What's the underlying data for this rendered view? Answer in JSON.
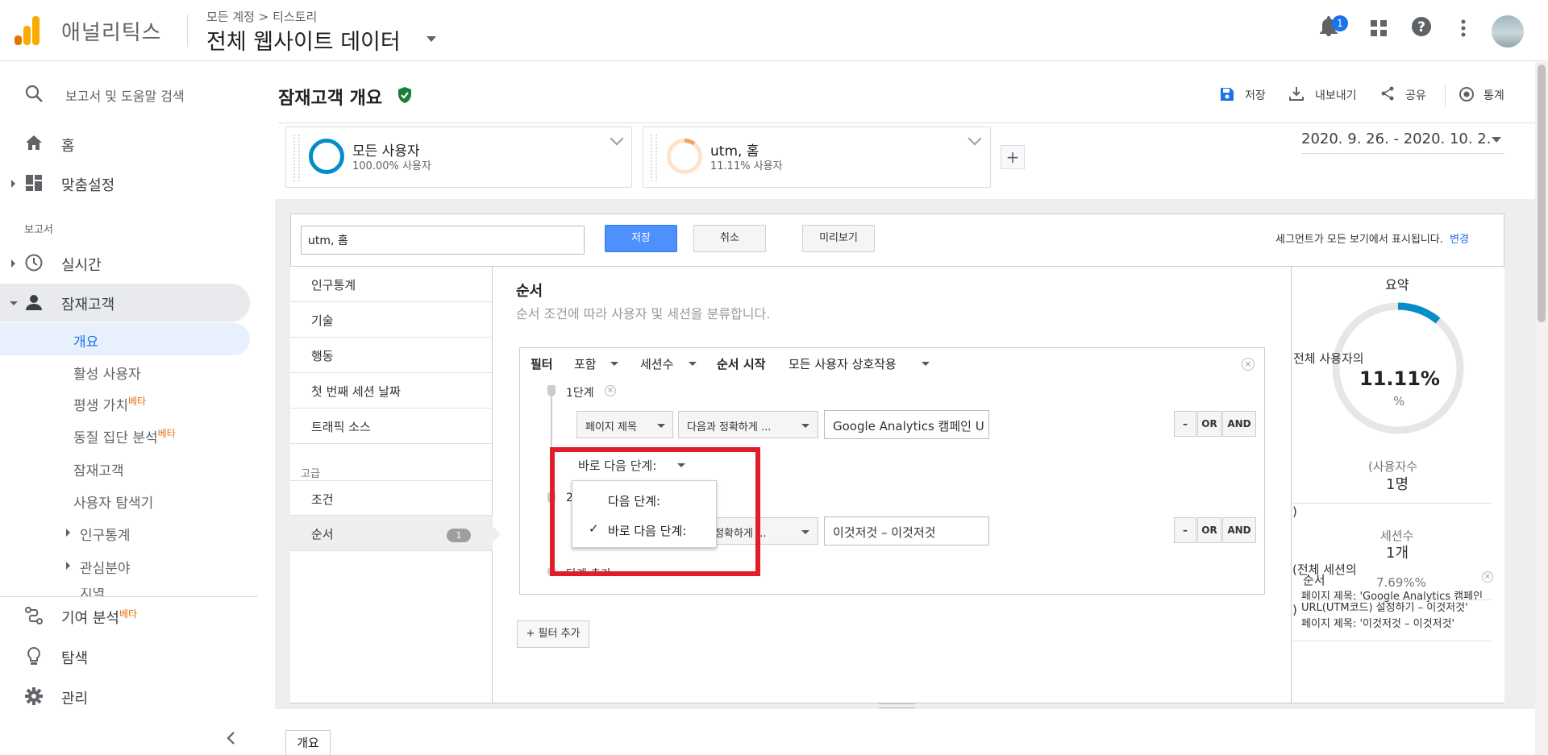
{
  "header": {
    "app_name": "애널리틱스",
    "breadcrumb_account": "모든 계정",
    "breadcrumb_sep": ">",
    "breadcrumb_property": "티스토리",
    "view_name": "전체 웹사이트 데이터",
    "notification_count": "1",
    "icons": [
      "bell-icon",
      "apps-icon",
      "help-icon",
      "more-vert-icon",
      "avatar"
    ]
  },
  "sidebar": {
    "search_placeholder": "보고서 및 도움말 검색",
    "home": "홈",
    "customization": "맞춤설정",
    "reports_section": "보고서",
    "realtime": "실시간",
    "audience": "잠재고객",
    "audience_items": [
      {
        "label": "개요",
        "beta": ""
      },
      {
        "label": "활성 사용자",
        "beta": ""
      },
      {
        "label": "평생 가치",
        "beta": "베타"
      },
      {
        "label": "동질 집단 분석",
        "beta": "베타"
      },
      {
        "label": "잠재고객",
        "beta": ""
      },
      {
        "label": "사용자 탐색기",
        "beta": ""
      },
      {
        "label": "인구통계",
        "beta": ""
      },
      {
        "label": "관심분야",
        "beta": ""
      },
      {
        "label": "지역",
        "beta": ""
      }
    ],
    "attribution": "기여 분석",
    "attribution_beta": "베타",
    "discover": "탐색",
    "admin": "관리"
  },
  "page": {
    "title": "잠재고객 개요",
    "actions": {
      "save": "저장",
      "export": "내보내기",
      "share": "공유",
      "insights": "통계"
    },
    "segments": [
      {
        "title": "모든 사용자",
        "sub": "100.00% 사용자",
        "color": "#058dc7"
      },
      {
        "title": "utm, 홈",
        "sub": "11.11% 사용자",
        "color": "#f5a45d"
      }
    ],
    "plus": "+",
    "date_range": "2020. 9. 26. - 2020. 10. 2."
  },
  "editor": {
    "segment_name": "utm, 홈",
    "save": "저장",
    "cancel": "취소",
    "preview": "미리보기",
    "visibility_text": "세그먼트가 모든 보기에서 표시됩니다.",
    "change_link": "변경",
    "categories": [
      "인구통계",
      "기술",
      "행동",
      "첫 번째 세션 날짜",
      "트래픽 소스"
    ],
    "advanced_label": "고급",
    "advanced": [
      "조건",
      "순서"
    ],
    "sequence_badge": "1",
    "sequence_title": "순서",
    "sequence_desc": "순서 조건에 따라 사용자 및 세션을 분류합니다.",
    "filter_label": "필터",
    "include": "포함",
    "sessions": "세션수",
    "seq_start_label": "순서 시작",
    "seq_start_value": "모든 사용자 상호작용",
    "step1_label": "1단계",
    "step2_label": "2",
    "step1_dim": "페이지 제목",
    "step1_match": "다음과 정확하게 ...",
    "step1_value": "Google Analytics 캠페인 U",
    "step2_match": "과 정확하게 ...",
    "step2_value": "이것저것 – 이것저것",
    "op_minus": "–",
    "op_or": "OR",
    "op_and": "AND",
    "next_step_selector": "바로 다음 단계:",
    "dropdown_options": [
      "다음 단계:",
      "바로 다음 단계:"
    ],
    "dropdown_checked": "✓",
    "add_step": "단계 추가",
    "add_filter": "+ 필터 추가"
  },
  "summary": {
    "title": "요약",
    "percent_prefix": "전체 사용자의",
    "percent": "11.11%",
    "percent_unit": "%",
    "users_label": "(사용자수",
    "users_value": "1명",
    "paren_close": ")",
    "sessions_label": "세션수",
    "sessions_value": "1개",
    "sessions_prefix": "(전체 세션의",
    "sessions_pct": "7.69%%",
    "seq_label": "순서",
    "seq_line1": "페이지 제목: 'Google Analytics 캠페인",
    "seq_line2": "URL(UTM코드) 설정하기 – 이것저것'",
    "seq_line3": "페이지 제목: '이것저것 – 이것저것'",
    "gauge_fraction": 0.1111
  },
  "bottom_tab": "개요",
  "colors": {
    "accent": "#1a73e8",
    "save_blue": "#4d90fe",
    "highlight_red": "#e21d2b",
    "beta_orange": "#e8710a",
    "verified_green": "#188038"
  }
}
